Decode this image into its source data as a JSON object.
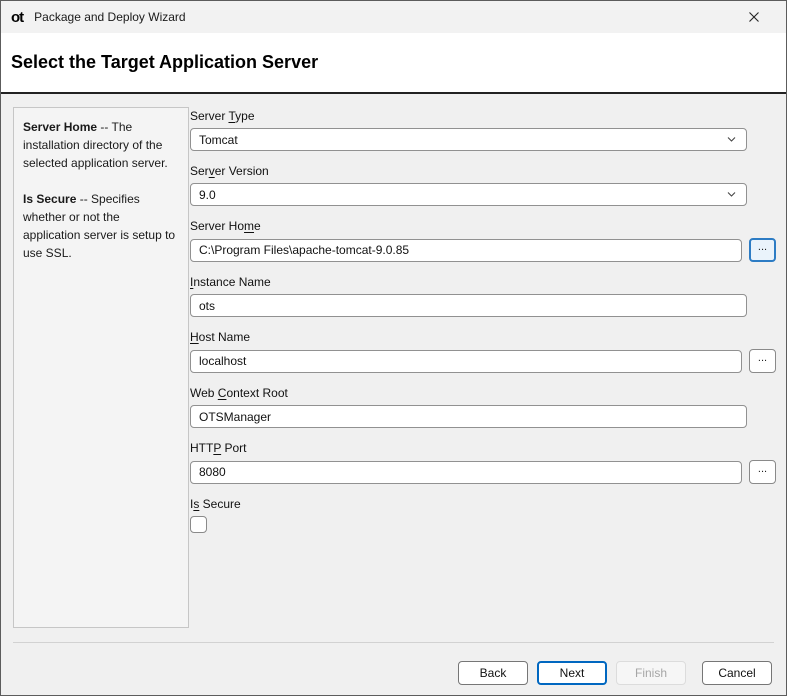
{
  "window": {
    "icon_text": "ot",
    "title": "Package and Deploy Wizard"
  },
  "header": {
    "title": "Select the Target Application Server"
  },
  "sidebar": {
    "help": [
      {
        "term": "Server Home",
        "sep": " -- ",
        "text": "The installation directory of the selected application server."
      },
      {
        "term": "Is Secure",
        "sep": " -- ",
        "text": "Specifies whether or not the application server is setup to use SSL."
      }
    ]
  },
  "form": {
    "server_type": {
      "label_pre": "Server ",
      "label_key": "T",
      "label_post": "ype",
      "value": "Tomcat"
    },
    "server_version": {
      "label_pre": "Ser",
      "label_key": "v",
      "label_post": "er Version",
      "value": "9.0"
    },
    "server_home": {
      "label_pre": "Server Ho",
      "label_key": "m",
      "label_post": "e",
      "value": "C:\\Program Files\\apache-tomcat-9.0.85",
      "browse_label": "...",
      "state": "browse-focused"
    },
    "instance_name": {
      "label_pre": "",
      "label_key": "I",
      "label_post": "nstance Name",
      "value": "ots"
    },
    "host_name": {
      "label_pre": "",
      "label_key": "H",
      "label_post": "ost Name",
      "value": "localhost",
      "browse_label": "..."
    },
    "web_context_root": {
      "label_pre": "Web ",
      "label_key": "C",
      "label_post": "ontext Root",
      "value": "OTSManager"
    },
    "http_port": {
      "label_pre": "HTT",
      "label_key": "P",
      "label_post": " Port",
      "value": "8080",
      "browse_label": "..."
    },
    "is_secure": {
      "label_pre": "I",
      "label_key": "s",
      "label_post": " Secure",
      "checked": false
    }
  },
  "footer": {
    "back_label": "Back",
    "next_label": "Next",
    "finish_label": "Finish",
    "cancel_label": "Cancel",
    "next_state": "default",
    "finish_state": "disabled"
  },
  "colors": {
    "accent_blue": "#0067c0",
    "titlebar_bg": "#f2f2f2",
    "content_bg": "#f0f0f0",
    "header_separator": "#222222"
  }
}
